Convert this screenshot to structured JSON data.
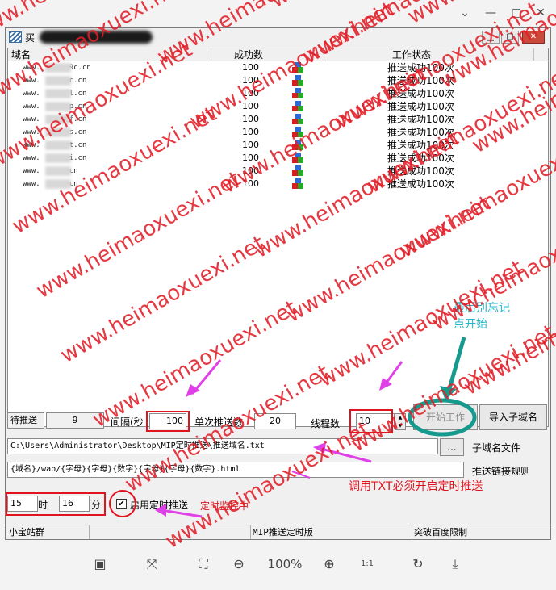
{
  "viewer": {
    "zoom": "100%"
  },
  "app": {
    "title_visible": "买",
    "list": {
      "headers": [
        "域名",
        "成功数",
        "工作状态"
      ],
      "rows": [
        {
          "domain_start": "www.",
          "domain_end": "9c.cn",
          "count": "100",
          "status": "推送成功100次"
        },
        {
          "domain_start": "www.",
          "domain_end": "c.cn",
          "count": "100",
          "status": "推送成功100次"
        },
        {
          "domain_start": "www.",
          "domain_end": "l.cn",
          "count": "100",
          "status": "推送成功100次"
        },
        {
          "domain_start": "www.",
          "domain_end": "p.cn",
          "count": "100",
          "status": "推送成功100次"
        },
        {
          "domain_start": "www.",
          "domain_end": "f.cn",
          "count": "100",
          "status": "推送成功100次"
        },
        {
          "domain_start": "www.",
          "domain_end": "s.cn",
          "count": "100",
          "status": "推送成功100次"
        },
        {
          "domain_start": "www.",
          "domain_end": "t.cn",
          "count": "100",
          "status": "推送成功100次"
        },
        {
          "domain_start": "www.",
          "domain_end": "i.cn",
          "count": "100",
          "status": "推送成功100次"
        },
        {
          "domain_start": "www.",
          "domain_end": "cn",
          "count": "100",
          "status": "推送成功100次"
        },
        {
          "domain_start": "www.",
          "domain_end": "cn",
          "count": "100",
          "status": "推送成功100次"
        }
      ]
    },
    "controls": {
      "pending_label": "待推送",
      "pending_value": "9",
      "interval_label": "间隔(秒",
      "interval_value": "100",
      "single_count_label": "单次推送数",
      "single_count_value": "20",
      "threads_label": "线程数",
      "threads_value": "10",
      "start_button": "开始工作",
      "import_button": "导入子域名",
      "file_path": "C:\\Users\\Administrator\\Desktop\\MIP定时推送\\推送域名.txt",
      "browse_button": "...",
      "file_label": "子域名文件",
      "rule_value": "{域名}/wap/{字母}{字母}{数字}{字母}{字母}{数字}.html",
      "rule_label": "推送链接规则",
      "hour_value": "15",
      "hour_label": "时",
      "minute_value": "16",
      "minute_label": "分",
      "timer_check_label": "启用定时推送",
      "timer_checked": "✔"
    },
    "statusbar": [
      "小宝站群",
      "",
      "MIP推送定时版",
      "突破百度限制"
    ]
  },
  "annotations": {
    "reminder": "最后别忘记点开始",
    "reminder_line1": "最后别忘记",
    "reminder_line2": "点开始",
    "txt_note": "调用TXT必须开启定时推送",
    "monitor_note": "定时监控中",
    "color_red": "#e0141e",
    "color_magenta": "#e040e8",
    "color_teal": "#179a8e"
  },
  "watermark": {
    "text": "www.heimaoxuexi.net"
  }
}
